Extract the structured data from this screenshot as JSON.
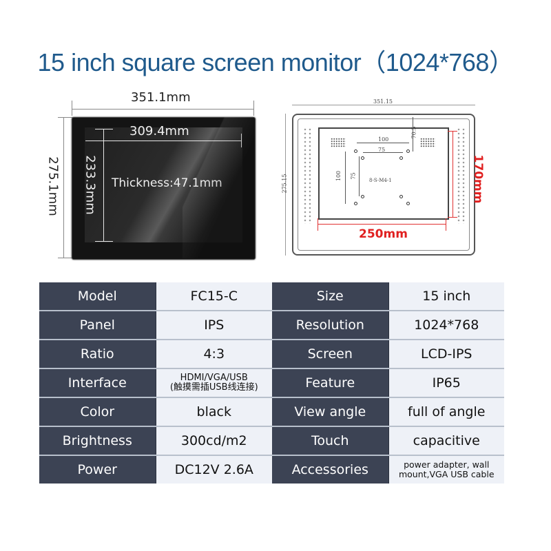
{
  "title": "15 inch square screen monitor（1024*768）",
  "front_view": {
    "outer_width": "351.1mm",
    "outer_height": "275.1mm",
    "screen_width": "309.4mm",
    "screen_height": "233.3mm",
    "thickness": "Thickness:47.1mm"
  },
  "back_drawing": {
    "overall_width": "351.15",
    "overall_height": "275.15",
    "vesa_outer": "100",
    "vesa_inner": "75",
    "vesa_outer_v": "100",
    "vesa_inner_v": "75",
    "offset": "70.5",
    "screw_label": "8-S-M4-1",
    "cutout_width": "250mm",
    "cutout_height": "170mm",
    "highlight_color": "#e02020"
  },
  "specs": {
    "rows": [
      {
        "k1": "Model",
        "v1": "FC15-C",
        "k2": "Size",
        "v2": "15 inch"
      },
      {
        "k1": "Panel",
        "v1": "IPS",
        "k2": "Resolution",
        "v2": "1024*768"
      },
      {
        "k1": "Ratio",
        "v1": "4:3",
        "k2": "Screen",
        "v2": "LCD-IPS"
      },
      {
        "k1": "Interface",
        "v1": "HDMI/VGA/USB",
        "v1_line2": "(触摸需插USB线连接)",
        "k2": "Feature",
        "v2": "IP65"
      },
      {
        "k1": "Color",
        "v1": "black",
        "k2": "View angle",
        "v2": "full of angle"
      },
      {
        "k1": "Brightness",
        "v1": "300cd/m2",
        "k2": "Touch",
        "v2": "capacitive"
      },
      {
        "k1": "Power",
        "v1": "DC12V 2.6A",
        "k2": "Accessories",
        "v2": "power adapter, wall",
        "v2_line2": "mount,VGA USB cable"
      }
    ]
  },
  "colors": {
    "title": "#1f5a8c",
    "label_bg": "#3c4354",
    "value_bg": "#eef1f7"
  }
}
